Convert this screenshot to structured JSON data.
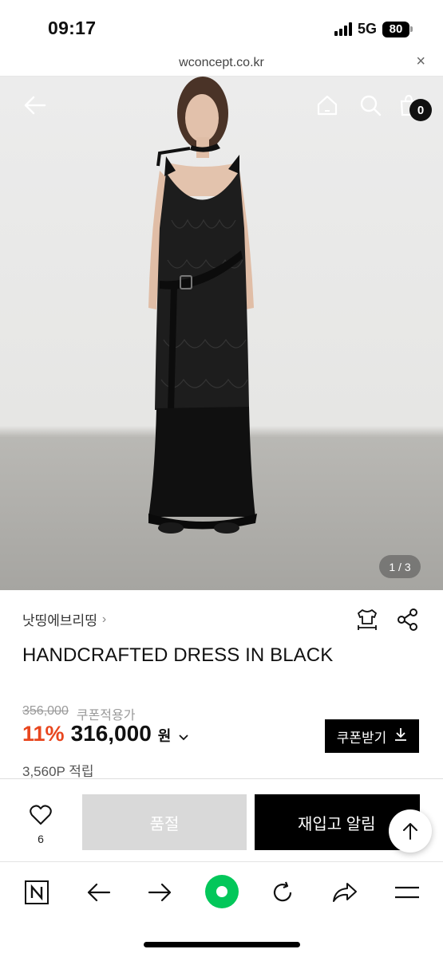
{
  "status_bar": {
    "time": "09:17",
    "network": "5G",
    "battery": "80"
  },
  "browser": {
    "url": "wconcept.co.kr",
    "close_symbol": "×"
  },
  "gallery": {
    "page_indicator": "1 / 3",
    "cart_count": "0"
  },
  "product": {
    "brand": "낫띵에브리띵",
    "brand_chevron": "›",
    "name": "HANDCRAFTED DRESS IN BLACK",
    "original_price": "356,000",
    "coupon_applicable": "쿠폰적용가",
    "discount_rate": "11%",
    "price": "316,000",
    "currency": "원",
    "currency_chevron": "⌄",
    "coupon_button_label": "쿠폰받기",
    "points": "3,560P 적립"
  },
  "purchase_bar": {
    "wish_count": "6",
    "soldout_label": "품절",
    "restock_label": "재입고 알림"
  },
  "colors": {
    "accent_discount": "#e8461e",
    "naver_green": "#03c75a",
    "primary": "#000000",
    "soldout_bg": "#d9d9d9"
  },
  "icons": [
    "back-arrow-icon",
    "home-icon",
    "search-icon",
    "cart-icon",
    "size-guide-icon",
    "share-icon",
    "heart-icon",
    "download-icon",
    "arrow-up-icon",
    "naver-n-icon",
    "prev-arrow-icon",
    "next-arrow-icon",
    "green-dot-icon",
    "refresh-icon",
    "share-forward-icon",
    "menu-icon"
  ]
}
